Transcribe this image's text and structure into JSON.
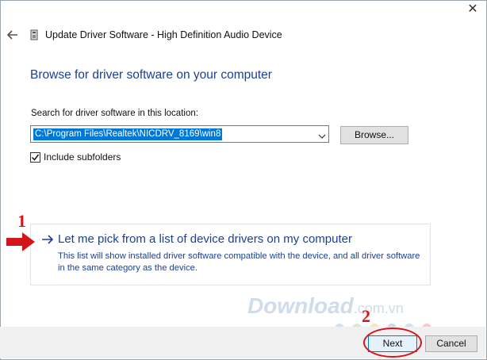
{
  "window": {
    "title": "Update Driver Software - High Definition Audio Device",
    "close_glyph": "✕",
    "icons": {
      "back": "back-arrow-icon",
      "device": "device-icon",
      "close": "close-icon"
    }
  },
  "page": {
    "heading": "Browse for driver software on your computer",
    "search_label": "Search for driver software in this location:",
    "path_value": "C:\\Program Files\\Realtek\\NICDRV_8169\\win8",
    "browse_label": "Browse...",
    "include_subfolders_label": "Include subfolders",
    "include_subfolders_checked": true,
    "pick_title": "Let me pick from a list of device drivers on my computer",
    "pick_description": "This list will show installed driver software compatible with the device, and all driver software in the same category as the device."
  },
  "footer": {
    "next_label": "Next",
    "cancel_label": "Cancel"
  },
  "annotations": {
    "step1": "1",
    "step2": "2",
    "watermark": "Download",
    "watermark_suffix": ".com.vn",
    "accent_color": "#d4141b"
  },
  "colors": {
    "heading": "#1c3f94",
    "selection": "#0078d7",
    "button_face": "#e1e1e1",
    "footer_bg": "#f0f0f0"
  }
}
